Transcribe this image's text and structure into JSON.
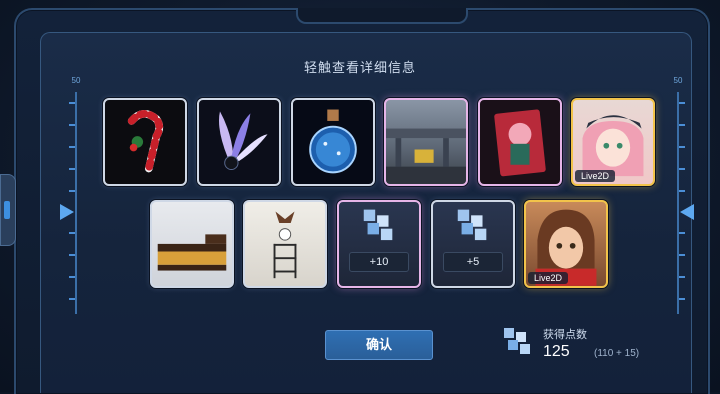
{
  "header": {
    "title": "轻触查看详细信息"
  },
  "gauges": {
    "left_value": "50",
    "right_value": "50"
  },
  "row1": [
    {
      "name": "candy-cane-icon",
      "frame": "white"
    },
    {
      "name": "feather-ornament-icon",
      "frame": "white"
    },
    {
      "name": "potion-bottle-icon",
      "frame": "white"
    },
    {
      "name": "city-street-background",
      "frame": "pink"
    },
    {
      "name": "character-card",
      "frame": "pink"
    },
    {
      "name": "pink-hair-character-portrait",
      "frame": "gold",
      "tag": "Live2D"
    }
  ],
  "row2": [
    {
      "name": "furniture-bench",
      "frame": "white"
    },
    {
      "name": "furniture-shelf",
      "frame": "white"
    },
    {
      "name": "cube-item",
      "frame": "pink",
      "count": "+10"
    },
    {
      "name": "cube-item",
      "frame": "white",
      "count": "+5"
    },
    {
      "name": "brown-hair-character-portrait",
      "frame": "gold",
      "tag": "Live2D"
    }
  ],
  "footer": {
    "confirm_label": "确认",
    "points_label": "获得点数",
    "points_value": "125",
    "points_detail": "(110 + 15)"
  },
  "colors": {
    "accent": "#2f6fb3",
    "gold_frame": "#f2c34a",
    "pink_frame": "#e6b5e8"
  }
}
